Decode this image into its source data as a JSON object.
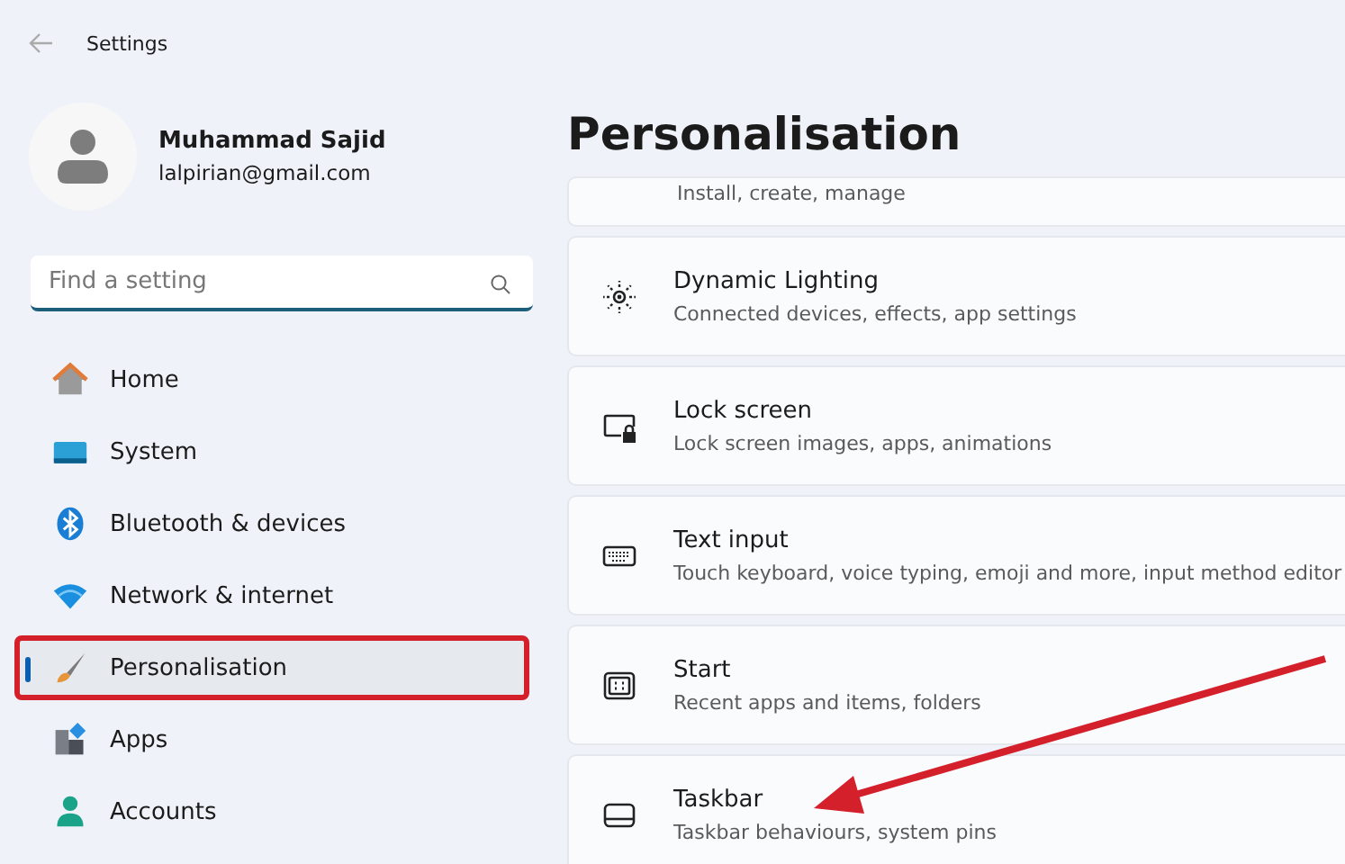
{
  "window": {
    "title": "Settings"
  },
  "profile": {
    "name": "Muhammad Sajid",
    "email": "lalpirian@gmail.com"
  },
  "search": {
    "placeholder": "Find a setting"
  },
  "sidebar": {
    "items": [
      {
        "kind": "home",
        "label": "Home",
        "selected": false,
        "highlighted": false
      },
      {
        "kind": "system",
        "label": "System",
        "selected": false,
        "highlighted": false
      },
      {
        "kind": "bluetooth",
        "label": "Bluetooth & devices",
        "selected": false,
        "highlighted": false
      },
      {
        "kind": "network",
        "label": "Network & internet",
        "selected": false,
        "highlighted": false
      },
      {
        "kind": "personalisation",
        "label": "Personalisation",
        "selected": true,
        "highlighted": true
      },
      {
        "kind": "apps",
        "label": "Apps",
        "selected": false,
        "highlighted": false
      },
      {
        "kind": "accounts",
        "label": "Accounts",
        "selected": false,
        "highlighted": false
      }
    ]
  },
  "page": {
    "title": "Personalisation",
    "cards": [
      {
        "kind": "partial",
        "description": "Install, create, manage"
      },
      {
        "kind": "lighting",
        "title": "Dynamic Lighting",
        "description": "Connected devices, effects, app settings"
      },
      {
        "kind": "lock",
        "title": "Lock screen",
        "description": "Lock screen images, apps, animations"
      },
      {
        "kind": "keyboard",
        "title": "Text input",
        "description": "Touch keyboard, voice typing, emoji and more, input method editor"
      },
      {
        "kind": "start",
        "title": "Start",
        "description": "Recent apps and items, folders"
      },
      {
        "kind": "taskbar",
        "title": "Taskbar",
        "description": "Taskbar behaviours, system pins"
      }
    ]
  }
}
